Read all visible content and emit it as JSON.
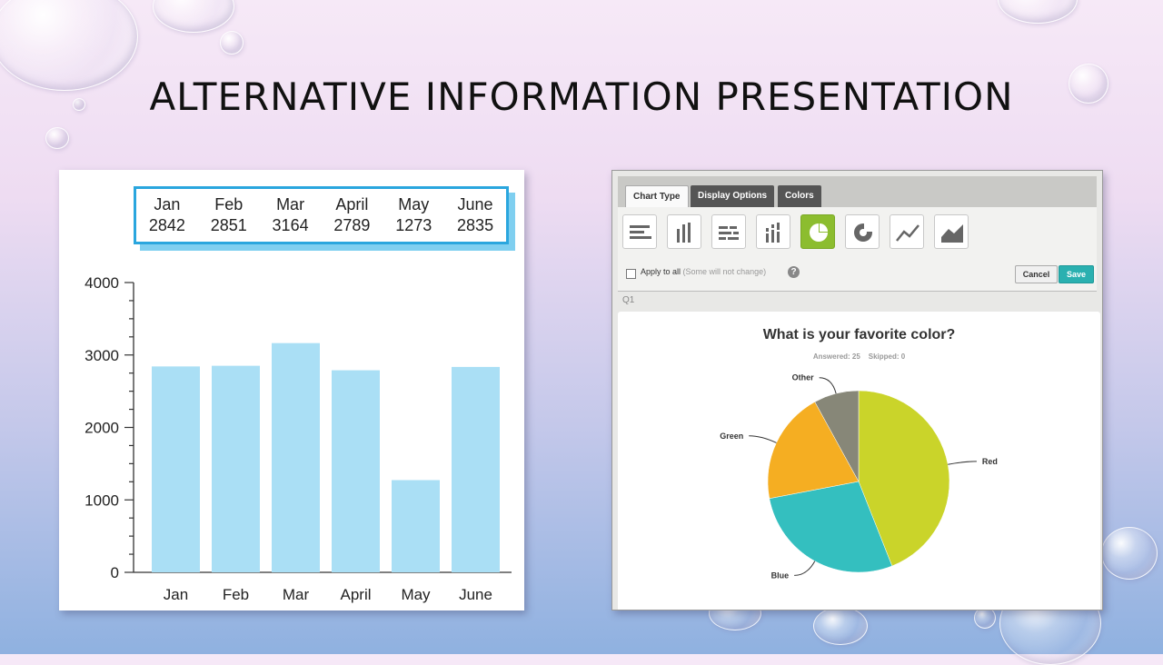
{
  "slide": {
    "title": "ALTERNATIVE INFORMATION PRESENTATION"
  },
  "colors": {
    "bar": "#aadff5",
    "data_box_border": "#2aa6de",
    "pie_red": "#cad42a",
    "pie_blue": "#34bfbf",
    "pie_green": "#f5ae22",
    "pie_other": "#878778",
    "save": "#2ab0b0",
    "active_chart_type": "#8cbd2f"
  },
  "data_table": {
    "months": [
      "Jan",
      "Feb",
      "Mar",
      "April",
      "May",
      "June"
    ],
    "values": [
      "2842",
      "2851",
      "3164",
      "2789",
      "1273",
      "2835"
    ]
  },
  "chart_data": [
    {
      "type": "bar",
      "categories": [
        "Jan",
        "Feb",
        "Mar",
        "April",
        "May",
        "June"
      ],
      "values": [
        2842,
        2851,
        3164,
        2789,
        1273,
        2835
      ],
      "ylim": [
        0,
        4000
      ],
      "yticks": [
        0,
        1000,
        2000,
        3000,
        4000
      ],
      "ytick_labels": [
        "0",
        "1000",
        "2000",
        "3000",
        "4000"
      ],
      "title": "",
      "xlabel": "",
      "ylabel": "",
      "grid": false
    },
    {
      "type": "pie",
      "title": "What is your favorite color?",
      "labels": [
        "Red",
        "Blue",
        "Green",
        "Other"
      ],
      "values": [
        11,
        7,
        5,
        2
      ]
    }
  ],
  "editor": {
    "tabs": [
      "Chart Type",
      "Display Options",
      "Colors"
    ],
    "chart_type_icons": [
      "horizontal-bar-chart-icon",
      "vertical-bar-chart-icon",
      "stacked-horizontal-bar-icon",
      "stacked-vertical-bar-icon",
      "pie-chart-icon",
      "donut-chart-icon",
      "line-chart-icon",
      "area-chart-icon"
    ],
    "apply_label": "Apply to all",
    "apply_note": "(Some will not change)",
    "help_symbol": "?",
    "cancel_label": "Cancel",
    "save_label": "Save",
    "question_label": "Q1",
    "answered": "Answered: 25",
    "skipped": "Skipped: 0"
  }
}
